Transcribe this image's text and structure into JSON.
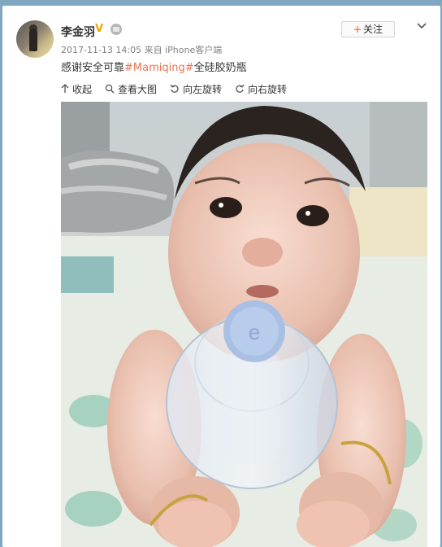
{
  "post": {
    "username": "李金羽",
    "vip_icon": "verified-v-icon",
    "member_icon": "member-badge-icon",
    "timestamp": "2017-11-13 14:05",
    "source": "来自 iPhone客户端",
    "text_before": "感谢安全可靠",
    "hashtag": "#Mamiqing#",
    "text_after": "全硅胶奶瓶",
    "follow_plus": "+",
    "follow_label": "关注"
  },
  "toolbar": {
    "collapse": "收起",
    "view_large": "查看大图",
    "rotate_left": "向左旋转",
    "rotate_right": "向右旋转"
  },
  "colors": {
    "page_background": "#7fa7c2",
    "hashtag": "#eb7350",
    "vip": "#f0a500",
    "follow_plus": "#ff8140"
  }
}
